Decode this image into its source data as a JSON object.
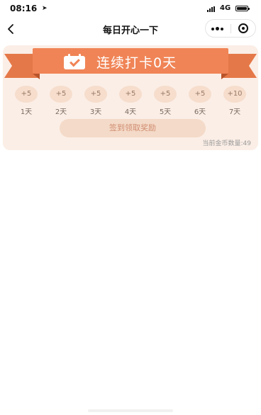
{
  "status_bar": {
    "time": "08:16",
    "network": "4G",
    "icons": [
      "location-arrow-icon",
      "signal-icon",
      "battery-icon"
    ]
  },
  "nav": {
    "title": "每日开心一下",
    "icons": [
      "back-chevron-icon",
      "more-dots-icon",
      "close-target-icon"
    ]
  },
  "checkin": {
    "title": "连续打卡0天",
    "icon": "calendar-check-icon",
    "rewards": [
      {
        "coins": "+5",
        "day": "1天"
      },
      {
        "coins": "+5",
        "day": "2天"
      },
      {
        "coins": "+5",
        "day": "3天"
      },
      {
        "coins": "+5",
        "day": "4天"
      },
      {
        "coins": "+5",
        "day": "5天"
      },
      {
        "coins": "+5",
        "day": "6天"
      },
      {
        "coins": "+10",
        "day": "7天"
      }
    ],
    "claim_label": "签到领取奖励",
    "coin_balance": "当前金币数量:49"
  },
  "colors": {
    "ribbon": "#f08456",
    "ribbon_tail": "#e57848",
    "card_bg": "#fbeee6",
    "bubble_bg": "#f6ddcc",
    "claim_bg": "#f4dac8",
    "claim_text": "#d08c70"
  }
}
